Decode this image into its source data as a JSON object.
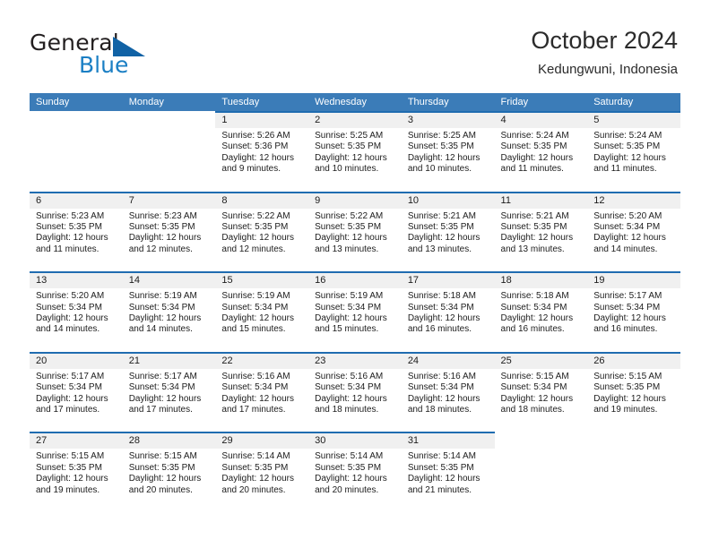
{
  "brand": {
    "name_part1": "General",
    "name_part2": "Blue",
    "logo_icon": "triangle-logo"
  },
  "header": {
    "title": "October 2024",
    "subtitle": "Kedungwuni, Indonesia"
  },
  "colors": {
    "header_blue": "#3b7cb8",
    "row_border_blue": "#1f6cb0",
    "daynum_bg": "#f0f0f0",
    "brand_blue": "#1b7fc4",
    "logo_blue": "#1162a5",
    "text": "#1c1c1c"
  },
  "weekdays": [
    "Sunday",
    "Monday",
    "Tuesday",
    "Wednesday",
    "Thursday",
    "Friday",
    "Saturday"
  ],
  "weeks": [
    [
      {
        "day": "",
        "empty": true
      },
      {
        "day": "",
        "empty": true
      },
      {
        "day": "1",
        "sunrise": "Sunrise: 5:26 AM",
        "sunset": "Sunset: 5:36 PM",
        "daylight1": "Daylight: 12 hours",
        "daylight2": "and 9 minutes."
      },
      {
        "day": "2",
        "sunrise": "Sunrise: 5:25 AM",
        "sunset": "Sunset: 5:35 PM",
        "daylight1": "Daylight: 12 hours",
        "daylight2": "and 10 minutes."
      },
      {
        "day": "3",
        "sunrise": "Sunrise: 5:25 AM",
        "sunset": "Sunset: 5:35 PM",
        "daylight1": "Daylight: 12 hours",
        "daylight2": "and 10 minutes."
      },
      {
        "day": "4",
        "sunrise": "Sunrise: 5:24 AM",
        "sunset": "Sunset: 5:35 PM",
        "daylight1": "Daylight: 12 hours",
        "daylight2": "and 11 minutes."
      },
      {
        "day": "5",
        "sunrise": "Sunrise: 5:24 AM",
        "sunset": "Sunset: 5:35 PM",
        "daylight1": "Daylight: 12 hours",
        "daylight2": "and 11 minutes."
      }
    ],
    [
      {
        "day": "6",
        "sunrise": "Sunrise: 5:23 AM",
        "sunset": "Sunset: 5:35 PM",
        "daylight1": "Daylight: 12 hours",
        "daylight2": "and 11 minutes."
      },
      {
        "day": "7",
        "sunrise": "Sunrise: 5:23 AM",
        "sunset": "Sunset: 5:35 PM",
        "daylight1": "Daylight: 12 hours",
        "daylight2": "and 12 minutes."
      },
      {
        "day": "8",
        "sunrise": "Sunrise: 5:22 AM",
        "sunset": "Sunset: 5:35 PM",
        "daylight1": "Daylight: 12 hours",
        "daylight2": "and 12 minutes."
      },
      {
        "day": "9",
        "sunrise": "Sunrise: 5:22 AM",
        "sunset": "Sunset: 5:35 PM",
        "daylight1": "Daylight: 12 hours",
        "daylight2": "and 13 minutes."
      },
      {
        "day": "10",
        "sunrise": "Sunrise: 5:21 AM",
        "sunset": "Sunset: 5:35 PM",
        "daylight1": "Daylight: 12 hours",
        "daylight2": "and 13 minutes."
      },
      {
        "day": "11",
        "sunrise": "Sunrise: 5:21 AM",
        "sunset": "Sunset: 5:35 PM",
        "daylight1": "Daylight: 12 hours",
        "daylight2": "and 13 minutes."
      },
      {
        "day": "12",
        "sunrise": "Sunrise: 5:20 AM",
        "sunset": "Sunset: 5:34 PM",
        "daylight1": "Daylight: 12 hours",
        "daylight2": "and 14 minutes."
      }
    ],
    [
      {
        "day": "13",
        "sunrise": "Sunrise: 5:20 AM",
        "sunset": "Sunset: 5:34 PM",
        "daylight1": "Daylight: 12 hours",
        "daylight2": "and 14 minutes."
      },
      {
        "day": "14",
        "sunrise": "Sunrise: 5:19 AM",
        "sunset": "Sunset: 5:34 PM",
        "daylight1": "Daylight: 12 hours",
        "daylight2": "and 14 minutes."
      },
      {
        "day": "15",
        "sunrise": "Sunrise: 5:19 AM",
        "sunset": "Sunset: 5:34 PM",
        "daylight1": "Daylight: 12 hours",
        "daylight2": "and 15 minutes."
      },
      {
        "day": "16",
        "sunrise": "Sunrise: 5:19 AM",
        "sunset": "Sunset: 5:34 PM",
        "daylight1": "Daylight: 12 hours",
        "daylight2": "and 15 minutes."
      },
      {
        "day": "17",
        "sunrise": "Sunrise: 5:18 AM",
        "sunset": "Sunset: 5:34 PM",
        "daylight1": "Daylight: 12 hours",
        "daylight2": "and 16 minutes."
      },
      {
        "day": "18",
        "sunrise": "Sunrise: 5:18 AM",
        "sunset": "Sunset: 5:34 PM",
        "daylight1": "Daylight: 12 hours",
        "daylight2": "and 16 minutes."
      },
      {
        "day": "19",
        "sunrise": "Sunrise: 5:17 AM",
        "sunset": "Sunset: 5:34 PM",
        "daylight1": "Daylight: 12 hours",
        "daylight2": "and 16 minutes."
      }
    ],
    [
      {
        "day": "20",
        "sunrise": "Sunrise: 5:17 AM",
        "sunset": "Sunset: 5:34 PM",
        "daylight1": "Daylight: 12 hours",
        "daylight2": "and 17 minutes."
      },
      {
        "day": "21",
        "sunrise": "Sunrise: 5:17 AM",
        "sunset": "Sunset: 5:34 PM",
        "daylight1": "Daylight: 12 hours",
        "daylight2": "and 17 minutes."
      },
      {
        "day": "22",
        "sunrise": "Sunrise: 5:16 AM",
        "sunset": "Sunset: 5:34 PM",
        "daylight1": "Daylight: 12 hours",
        "daylight2": "and 17 minutes."
      },
      {
        "day": "23",
        "sunrise": "Sunrise: 5:16 AM",
        "sunset": "Sunset: 5:34 PM",
        "daylight1": "Daylight: 12 hours",
        "daylight2": "and 18 minutes."
      },
      {
        "day": "24",
        "sunrise": "Sunrise: 5:16 AM",
        "sunset": "Sunset: 5:34 PM",
        "daylight1": "Daylight: 12 hours",
        "daylight2": "and 18 minutes."
      },
      {
        "day": "25",
        "sunrise": "Sunrise: 5:15 AM",
        "sunset": "Sunset: 5:34 PM",
        "daylight1": "Daylight: 12 hours",
        "daylight2": "and 18 minutes."
      },
      {
        "day": "26",
        "sunrise": "Sunrise: 5:15 AM",
        "sunset": "Sunset: 5:35 PM",
        "daylight1": "Daylight: 12 hours",
        "daylight2": "and 19 minutes."
      }
    ],
    [
      {
        "day": "27",
        "sunrise": "Sunrise: 5:15 AM",
        "sunset": "Sunset: 5:35 PM",
        "daylight1": "Daylight: 12 hours",
        "daylight2": "and 19 minutes."
      },
      {
        "day": "28",
        "sunrise": "Sunrise: 5:15 AM",
        "sunset": "Sunset: 5:35 PM",
        "daylight1": "Daylight: 12 hours",
        "daylight2": "and 20 minutes."
      },
      {
        "day": "29",
        "sunrise": "Sunrise: 5:14 AM",
        "sunset": "Sunset: 5:35 PM",
        "daylight1": "Daylight: 12 hours",
        "daylight2": "and 20 minutes."
      },
      {
        "day": "30",
        "sunrise": "Sunrise: 5:14 AM",
        "sunset": "Sunset: 5:35 PM",
        "daylight1": "Daylight: 12 hours",
        "daylight2": "and 20 minutes."
      },
      {
        "day": "31",
        "sunrise": "Sunrise: 5:14 AM",
        "sunset": "Sunset: 5:35 PM",
        "daylight1": "Daylight: 12 hours",
        "daylight2": "and 21 minutes."
      },
      {
        "day": "",
        "empty": true
      },
      {
        "day": "",
        "empty": true
      }
    ]
  ]
}
